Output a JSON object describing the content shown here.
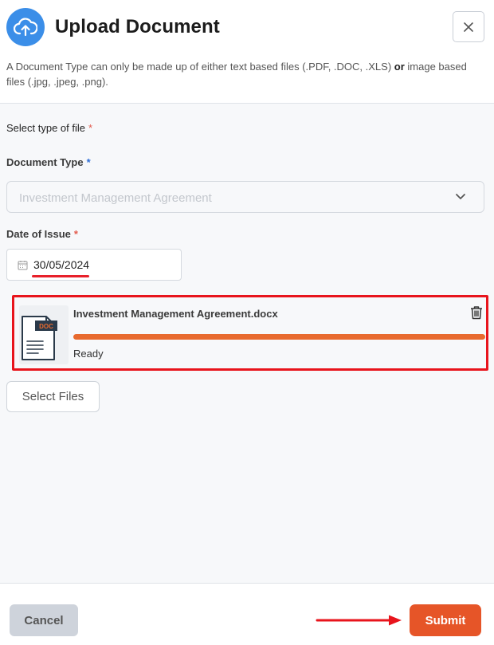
{
  "header": {
    "title": "Upload Document",
    "description_pre": "A Document Type can only be made up of either text based files (.PDF, .DOC, .XLS) ",
    "description_or": "or",
    "description_post": " image based files (.jpg, .jpeg, .png).",
    "close_icon": "x-icon",
    "upload_icon": "cloud-upload-icon"
  },
  "form": {
    "file_type_label": "Select type of file",
    "document_type_label": "Document Type",
    "document_type_value": "Investment Management Agreement",
    "date_label": "Date of Issue",
    "date_value": "30/05/2024",
    "required_marker": "*"
  },
  "file": {
    "name": "Investment Management Agreement.docx",
    "badge": "DOC",
    "status": "Ready",
    "progress": 1.0
  },
  "buttons": {
    "select_files": "Select Files",
    "cancel": "Cancel",
    "submit": "Submit"
  },
  "colors": {
    "accent_blue": "#3b8ee8",
    "submit_orange": "#e65528",
    "progress_orange": "#e86a2e",
    "annotation_red": "#e8141c"
  }
}
